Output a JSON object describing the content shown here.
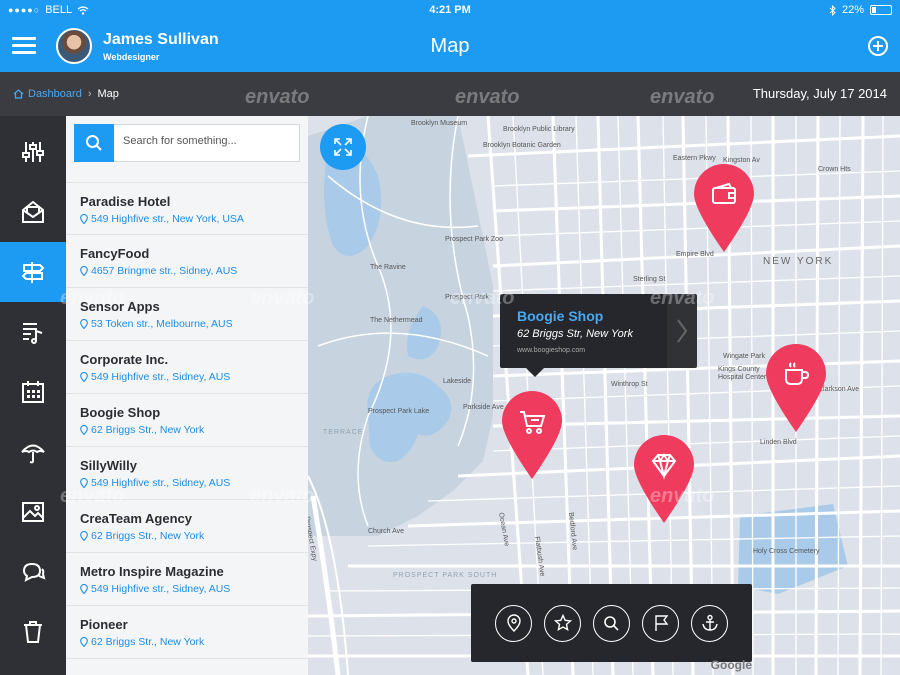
{
  "status_bar": {
    "carrier": "BELL",
    "time": "4:21 PM",
    "battery": "22%"
  },
  "header": {
    "user_name": "James Sullivan",
    "user_role": "Webdesigner",
    "title": "Map"
  },
  "breadcrumb": {
    "home": "Dashboard",
    "current": "Map"
  },
  "date": "Thursday, July 17 2014",
  "sidebar": {
    "items": [
      {
        "icon": "sliders-icon",
        "active": false
      },
      {
        "icon": "mail-icon",
        "active": false
      },
      {
        "icon": "signpost-icon",
        "active": true
      },
      {
        "icon": "music-list-icon",
        "active": false
      },
      {
        "icon": "calendar-icon",
        "active": false
      },
      {
        "icon": "umbrella-icon",
        "active": false
      },
      {
        "icon": "image-icon",
        "active": false
      },
      {
        "icon": "chat-icon",
        "active": false
      },
      {
        "icon": "trash-icon",
        "active": false
      }
    ]
  },
  "search": {
    "placeholder": "Search for something..."
  },
  "places": [
    {
      "name": "Paradise Hotel",
      "address": "549 Highfive str., New York, USA"
    },
    {
      "name": "FancyFood",
      "address": "4657 Bringme str., Sidney, AUS"
    },
    {
      "name": "Sensor Apps",
      "address": "53 Token str., Melbourne, AUS"
    },
    {
      "name": "Corporate Inc.",
      "address": "549 Highfive str., Sidney, AUS"
    },
    {
      "name": "Boogie Shop",
      "address": "62 Briggs Str., New York"
    },
    {
      "name": "SillyWilly",
      "address": "549 Highfive str., Sidney, AUS"
    },
    {
      "name": "CreaTeam Agency",
      "address": "62 Briggs Str., New York"
    },
    {
      "name": "Metro Inspire Magazine",
      "address": "549 Highfive str., Sidney, AUS"
    },
    {
      "name": "Pioneer",
      "address": "62 Briggs Str., New York"
    }
  ],
  "map": {
    "labels": {
      "brooklyn_museum": "Brooklyn Museum",
      "brooklyn_public_library": "Brooklyn Public Library",
      "botanic_garden": "Brooklyn Botanic Garden",
      "eastern_pkwy": "Eastern Pkwy",
      "new_york": "NEW YORK",
      "prospect_park_zoo": "Prospect Park Zoo",
      "the_ravine": "The Ravine",
      "the_nethermead": "The Nethermead",
      "prospect_park": "Prospect Park",
      "lakeside": "Lakeside",
      "prospect_park_lake": "Prospect Park Lake",
      "parkside_ave": "Parkside Ave",
      "church_ave": "Church Ave",
      "flatbush_ave": "Flatbush Ave",
      "bedford_ave": "Bedford Ave",
      "linden_blvd": "Linden Blvd",
      "clarkson_ave": "Clarkson Ave",
      "empire_blvd": "Empire Blvd",
      "sterling_st": "Sterling St",
      "winthrop_st": "Winthrop St",
      "wingate_park": "Wingate Park",
      "kings_county_center": "Kings County Hospital Center",
      "holy_cross_cemetery": "Holy Cross Cemetery",
      "prospect_park_south": "PROSPECT PARK SOUTH",
      "prospect_expy": "Prospect Expy",
      "ocean_ave": "Ocean Ave",
      "kingston_av": "Kingston Av",
      "crown_hts": "Crown Hts",
      "terrace": "TERRACE"
    },
    "google": "Google"
  },
  "popup": {
    "title": "Boogie Shop",
    "address": "62 Briggs Str, New York",
    "url": "www.boogieshop.com"
  },
  "pins": [
    {
      "icon": "wallet-icon"
    },
    {
      "icon": "coffee-icon"
    },
    {
      "icon": "cart-icon"
    },
    {
      "icon": "diamond-icon"
    }
  ],
  "toolbar": {
    "buttons": [
      "map-pin-icon",
      "star-icon",
      "search-icon",
      "flag-icon",
      "anchor-icon"
    ]
  },
  "colors": {
    "primary": "#1d9af2",
    "pin": "#ef3b5d",
    "dark": "#25272c",
    "water": "#a9cbe9"
  },
  "watermark": "envato"
}
